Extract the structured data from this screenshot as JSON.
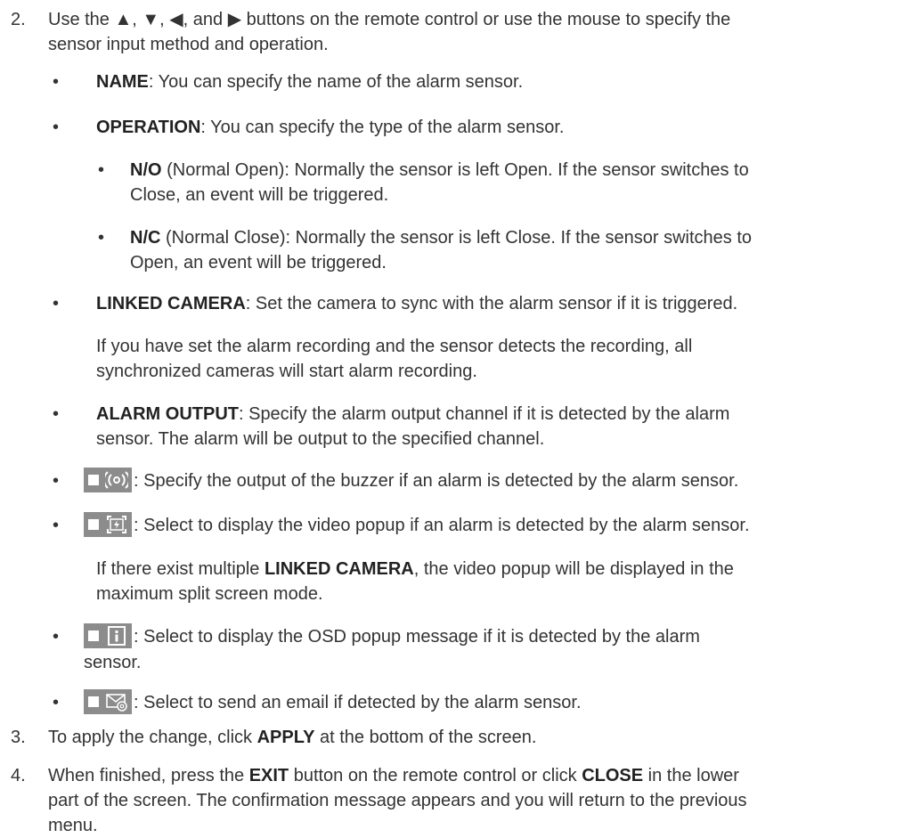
{
  "step2": {
    "num": "2.",
    "text_a": "Use the ▲, ▼, ◀, and ▶ buttons on the remote control or use the mouse to specify the",
    "text_b": "sensor input method and operation."
  },
  "name_item": {
    "term": "NAME",
    "desc": ": You can specify the name of the alarm sensor."
  },
  "operation_item": {
    "term": "OPERATION",
    "desc": ": You can specify the type of the alarm sensor."
  },
  "no_item": {
    "term": "N/O",
    "desc_a": " (Normal Open): Normally the sensor is left Open. If the sensor switches to",
    "desc_b": "Close, an event will be triggered."
  },
  "nc_item": {
    "term": "N/C",
    "desc_a": " (Normal Close): Normally the sensor is left Close. If the sensor switches to",
    "desc_b": "Open, an event will be triggered."
  },
  "linked_item": {
    "term": "LINKED CAMERA",
    "desc": ": Set the camera to sync with the alarm sensor if it is triggered."
  },
  "linked_para": {
    "a": "If you have set the alarm recording and the sensor detects the recording, all",
    "b": "synchronized cameras will start alarm recording."
  },
  "alarm_output_item": {
    "term": "ALARM OUTPUT",
    "desc_a": ": Specify the alarm output channel if it is detected by the alarm",
    "desc_b": "sensor. The alarm will be output to the specified channel."
  },
  "buzzer_item": {
    "icon": "buzzer-icon",
    "desc": ": Specify the output of the buzzer if an alarm is detected by the alarm sensor."
  },
  "popup_item": {
    "icon": "video-popup-icon",
    "desc": ": Select to display the video popup if an alarm is detected by the alarm sensor."
  },
  "popup_para": {
    "pre": "If there exist multiple ",
    "term": "LINKED CAMERA",
    "post": ", the video popup will be displayed in the",
    "b": "maximum split screen mode."
  },
  "osd_item": {
    "icon": "info-icon",
    "desc_a": ": Select to display the OSD popup message if it is detected by the alarm",
    "desc_b": "sensor."
  },
  "email_item": {
    "icon": "email-icon",
    "desc": ": Select to send an email if detected by the alarm sensor."
  },
  "step3": {
    "num": "3.",
    "pre": "To apply the change, click ",
    "term": "APPLY",
    "post": " at the bottom of the screen."
  },
  "step4": {
    "num": "4.",
    "pre": "When finished, press the ",
    "term1": "EXIT",
    "mid": " button on the remote control or click ",
    "term2": "CLOSE",
    "post": " in the lower",
    "b": "part of the screen. The confirmation message appears and you will return to the previous",
    "c": "menu."
  },
  "bullet_char": "•",
  "colors": {
    "text": "#333333",
    "icon_bg": "#8c8c8c",
    "icon_fg": "#ffffff"
  }
}
